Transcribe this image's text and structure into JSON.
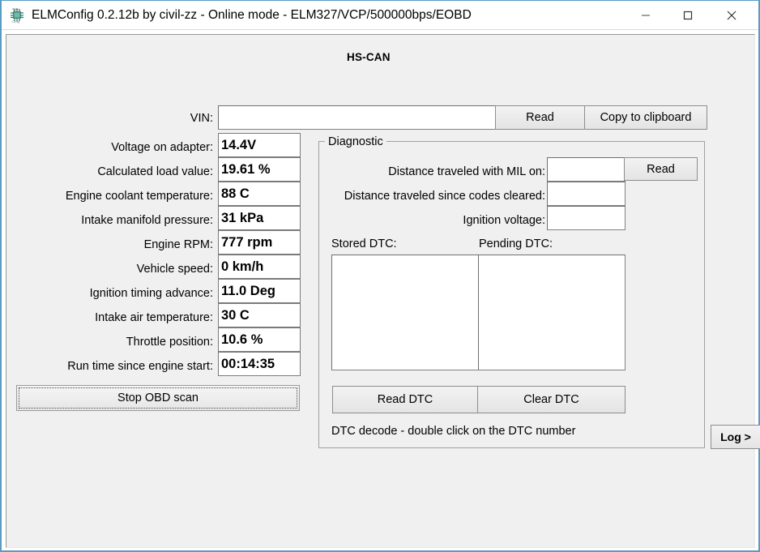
{
  "window": {
    "title": "ELMConfig 0.2.12b by civil-zz - Online mode - ELM327/VCP/500000bps/EOBD",
    "app_icon": "elmconfig-chip-icon",
    "minimize_label": "minimize-icon",
    "maximize_label": "maximize-icon",
    "close_label": "close-icon",
    "bg_color": "#f0f0f0",
    "border_color": "#5a9bc4"
  },
  "section": {
    "title": "HS-CAN"
  },
  "vin_row": {
    "label": "VIN:",
    "value": "",
    "placeholder": "",
    "read_label": "Read",
    "copy_label": "Copy to clipboard"
  },
  "parameters": [
    {
      "label": "Voltage on adapter:",
      "value": "14.4V"
    },
    {
      "label": "Calculated load value:",
      "value": "19.61 %"
    },
    {
      "label": "Engine coolant temperature:",
      "value": "88 C"
    },
    {
      "label": "Intake manifold pressure:",
      "value": "31 kPa"
    },
    {
      "label": "Engine RPM:",
      "value": "777 rpm"
    },
    {
      "label": "Vehicle speed:",
      "value": "0 km/h"
    },
    {
      "label": "Ignition timing advance:",
      "value": "11.0 Deg"
    },
    {
      "label": "Intake air temperature:",
      "value": "30 C"
    },
    {
      "label": "Throttle position:",
      "value": "10.6 %"
    },
    {
      "label": "Run time since engine start:",
      "value": "00:14:35"
    }
  ],
  "scan": {
    "stop_label": "Stop OBD scan",
    "focused": "true"
  },
  "diagnostic": {
    "group_label": "Diagnostic",
    "rows": [
      {
        "label": "Distance traveled with MIL on:",
        "value": ""
      },
      {
        "label": "Distance traveled since codes cleared:",
        "value": ""
      },
      {
        "label": "Ignition voltage:",
        "value": ""
      }
    ],
    "read_label": "Read",
    "stored_dtc_label": "Stored DTC:",
    "pending_dtc_label": "Pending DTC:",
    "stored_dtc_items": [],
    "pending_dtc_items": [],
    "read_dtc_label": "Read DTC",
    "clear_dtc_label": "Clear DTC",
    "hint": "DTC decode - double click on the DTC number"
  },
  "log": {
    "label": "Log >"
  }
}
